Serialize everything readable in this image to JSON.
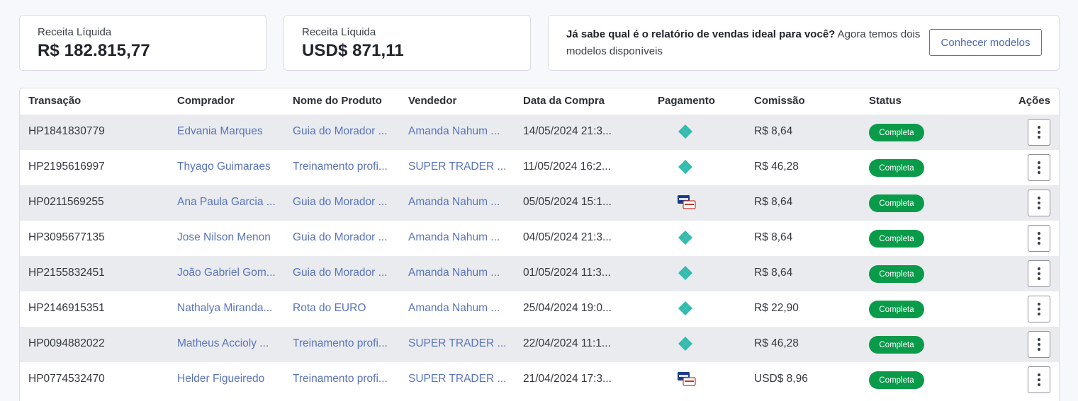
{
  "summary": {
    "brl": {
      "label": "Receita Líquida",
      "value": "R$ 182.815,77"
    },
    "usd": {
      "label": "Receita Líquida",
      "value": "USD$ 871,11"
    },
    "models": {
      "question": "Já sabe qual é o relatório de vendas ideal para você?",
      "text": " Agora temos dois modelos disponíveis",
      "button_label": "Conhecer modelos"
    }
  },
  "table": {
    "headers": {
      "transaction": "Transação",
      "buyer": "Comprador",
      "product": "Nome do Produto",
      "seller": "Vendedor",
      "date": "Data da Compra",
      "payment": "Pagamento",
      "commission": "Comissão",
      "status": "Status",
      "actions": "Ações"
    },
    "rows": [
      {
        "transaction": "HP1841830779",
        "buyer": "Edvania Marques",
        "product": "Guia do Morador ...",
        "seller": "Amanda Nahum ...",
        "date": "14/05/2024 21:3...",
        "payment": "pix-icon",
        "commission": "R$ 8,64",
        "status": "Completa"
      },
      {
        "transaction": "HP2195616997",
        "buyer": "Thyago Guimaraes",
        "product": "Treinamento profi...",
        "seller": "SUPER TRADER ...",
        "date": "11/05/2024 16:2...",
        "payment": "pix-icon",
        "commission": "R$ 46,28",
        "status": "Completa"
      },
      {
        "transaction": "HP0211569255",
        "buyer": "Ana Paula Garcia ...",
        "product": "Guia do Morador ...",
        "seller": "Amanda Nahum ...",
        "date": "05/05/2024 15:1...",
        "payment": "card-icon",
        "commission": "R$ 8,64",
        "status": "Completa"
      },
      {
        "transaction": "HP3095677135",
        "buyer": "Jose Nilson Menon",
        "product": "Guia do Morador ...",
        "seller": "Amanda Nahum ...",
        "date": "04/05/2024 21:3...",
        "payment": "pix-icon",
        "commission": "R$ 8,64",
        "status": "Completa"
      },
      {
        "transaction": "HP2155832451",
        "buyer": "João Gabriel Gom...",
        "product": "Guia do Morador ...",
        "seller": "Amanda Nahum ...",
        "date": "01/05/2024 11:3...",
        "payment": "pix-icon",
        "commission": "R$ 8,64",
        "status": "Completa"
      },
      {
        "transaction": "HP2146915351",
        "buyer": "Nathalya Miranda...",
        "product": "Rota do EURO",
        "seller": "Amanda Nahum ...",
        "date": "25/04/2024 19:0...",
        "payment": "pix-icon",
        "commission": "R$ 22,90",
        "status": "Completa"
      },
      {
        "transaction": "HP0094882022",
        "buyer": "Matheus Accioly ...",
        "product": "Treinamento profi...",
        "seller": "SUPER TRADER ...",
        "date": "22/04/2024 11:1...",
        "payment": "pix-icon",
        "commission": "R$ 46,28",
        "status": "Completa"
      },
      {
        "transaction": "HP0774532470",
        "buyer": "Helder Figueiredo",
        "product": "Treinamento profi...",
        "seller": "SUPER TRADER ...",
        "date": "21/04/2024 17:3...",
        "payment": "card-icon",
        "commission": "USD$ 8,96",
        "status": "Completa"
      }
    ]
  },
  "colors": {
    "accent": "#5a74bd",
    "status_complete": "#0a9b4a",
    "pix": "#32bcad"
  }
}
